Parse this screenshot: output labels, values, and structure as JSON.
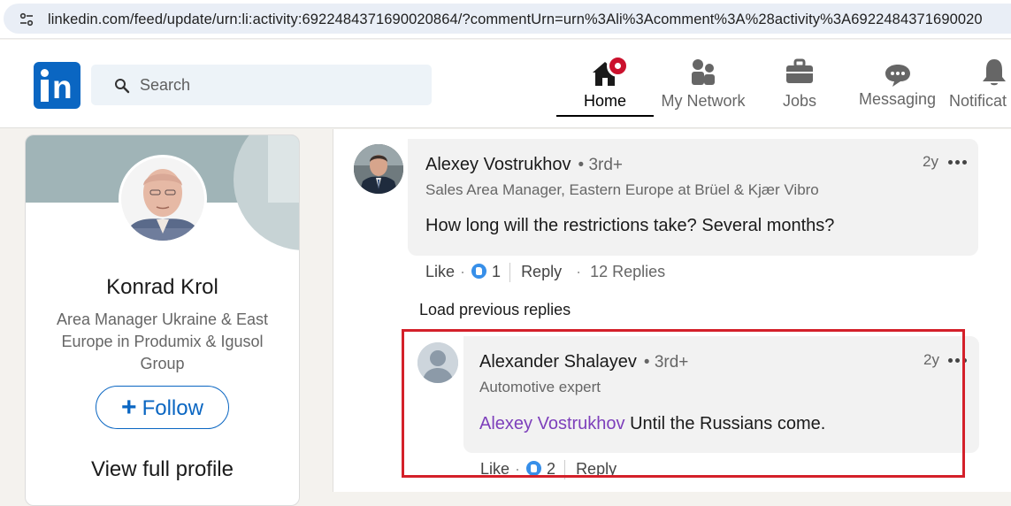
{
  "browser": {
    "url": "linkedin.com/feed/update/urn:li:activity:6922484371690020864/?commentUrn=urn%3Ali%3Acomment%3A%28activity%3A6922484371690020"
  },
  "nav": {
    "search_placeholder": "Search",
    "items": [
      {
        "label": "Home"
      },
      {
        "label": "My Network"
      },
      {
        "label": "Jobs"
      },
      {
        "label": "Messaging"
      },
      {
        "label": "Notificat"
      }
    ],
    "accent": "#0a66c2",
    "badge_color": "#cb112d"
  },
  "profile": {
    "name": "Konrad Krol",
    "headline": "Area Manager Ukraine & East Europe in Produmix & Igusol Group",
    "follow_label": "Follow",
    "view_profile_label": "View full profile"
  },
  "comment1": {
    "author": "Alexey Vostrukhov",
    "degree": "• 3rd+",
    "headline": "Sales Area Manager, Eastern Europe at Brüel & Kjær Vibro",
    "text": "How long will the restrictions take? Several months?",
    "time": "2y",
    "like_label": "Like",
    "like_count": "1",
    "reply_label": "Reply",
    "replies_label": "12 Replies"
  },
  "load_previous_label": "Load previous replies",
  "comment2": {
    "author": "Alexander Shalayev",
    "degree": "• 3rd+",
    "headline": "Automotive expert",
    "mention": "Alexey Vostrukhov",
    "text": " Until the Russians come.",
    "time": "2y",
    "like_label": "Like",
    "like_count": "2",
    "reply_label": "Reply"
  },
  "highlight_color": "#d4202a"
}
